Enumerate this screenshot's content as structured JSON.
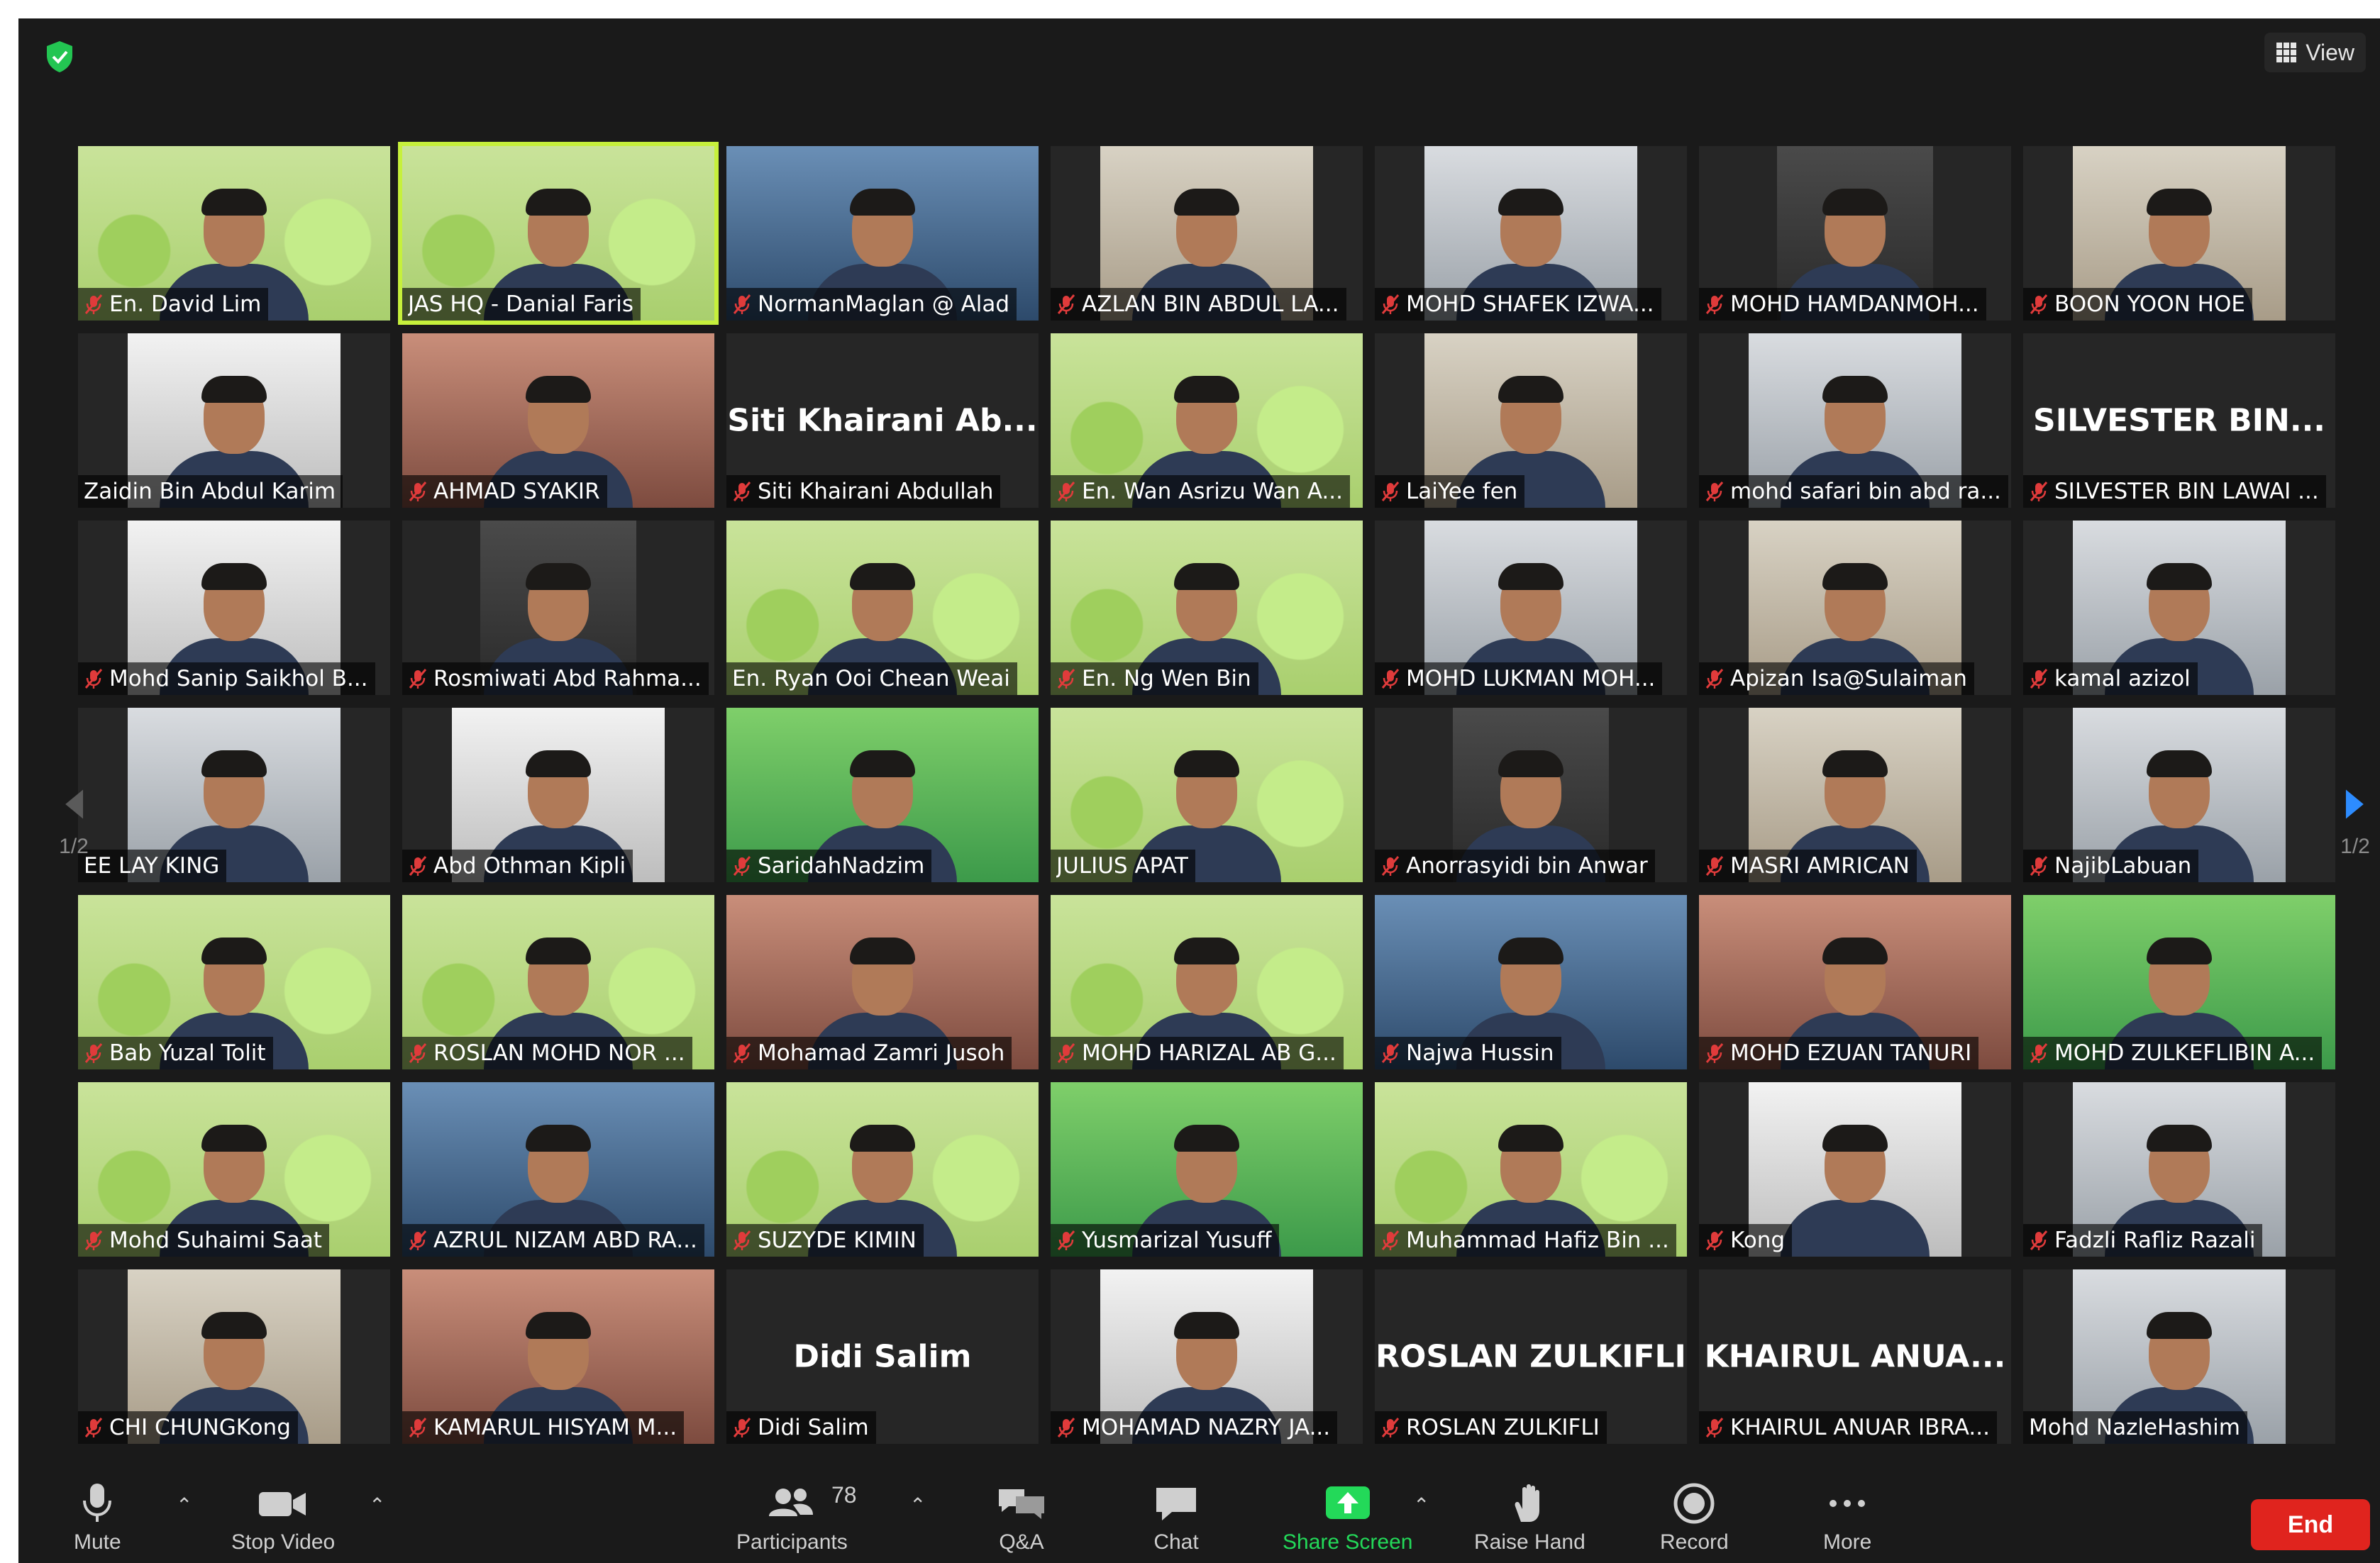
{
  "header": {
    "view_label": "View"
  },
  "pagination": {
    "left": "1/2",
    "right": "1/2"
  },
  "participants": [
    {
      "label": "En. David Lim",
      "muted": true,
      "bg": "banner"
    },
    {
      "label": "JAS HQ - Danial Faris",
      "muted": false,
      "bg": "banner",
      "active": true
    },
    {
      "label": "NormanMaglan @ Alad",
      "muted": true,
      "bg": "blue"
    },
    {
      "label": "AZLAN BIN ABDUL LA...",
      "muted": true,
      "bg": "room"
    },
    {
      "label": "MOHD SHAFEK IZWA...",
      "muted": true,
      "bg": "office"
    },
    {
      "label": "MOHD HAMDANMOH...",
      "muted": true,
      "bg": "dark"
    },
    {
      "label": "BOON YOON HOE",
      "muted": true,
      "bg": "room"
    },
    {
      "label": "Zaidin Bin Abdul Karim",
      "muted": false,
      "bg": "ceiling"
    },
    {
      "label": "AHMAD SYAKIR",
      "muted": true,
      "bg": "red"
    },
    {
      "label": "Siti Khairani Abdullah",
      "muted": true,
      "bg": "plain",
      "name_text": "Siti Khairani Ab..."
    },
    {
      "label": "En. Wan Asrizu Wan A...",
      "muted": true,
      "bg": "banner"
    },
    {
      "label": "LaiYee fen",
      "muted": true,
      "bg": "room"
    },
    {
      "label": "mohd safari bin abd ra...",
      "muted": true,
      "bg": "office"
    },
    {
      "label": "SILVESTER BIN LAWAI ...",
      "muted": true,
      "bg": "plain",
      "name_text": "SILVESTER BIN..."
    },
    {
      "label": "Mohd Sanip Saikhol B...",
      "muted": true,
      "bg": "ceiling"
    },
    {
      "label": "Rosmiwati Abd Rahma...",
      "muted": true,
      "bg": "dark"
    },
    {
      "label": "En. Ryan Ooi Chean Weai",
      "muted": false,
      "bg": "banner"
    },
    {
      "label": "En. Ng Wen Bin",
      "muted": true,
      "bg": "banner"
    },
    {
      "label": "MOHD LUKMAN MOH...",
      "muted": true,
      "bg": "office"
    },
    {
      "label": "Apizan Isa@Sulaiman",
      "muted": true,
      "bg": "room"
    },
    {
      "label": "kamal azizol",
      "muted": true,
      "bg": "office"
    },
    {
      "label": "EE LAY KING",
      "muted": false,
      "bg": "office"
    },
    {
      "label": "Abd Othman Kipli",
      "muted": true,
      "bg": "ceiling"
    },
    {
      "label": "SaridahNadzim",
      "muted": true,
      "bg": "green"
    },
    {
      "label": "JULIUS APAT",
      "muted": false,
      "bg": "banner"
    },
    {
      "label": "Anorrasyidi bin Anwar",
      "muted": true,
      "bg": "dark"
    },
    {
      "label": "MASRI AMRICAN",
      "muted": true,
      "bg": "room"
    },
    {
      "label": "NajibLabuan",
      "muted": true,
      "bg": "office"
    },
    {
      "label": "Bab Yuzal Tolit",
      "muted": true,
      "bg": "banner"
    },
    {
      "label": "ROSLAN MOHD NOR ...",
      "muted": true,
      "bg": "banner"
    },
    {
      "label": "Mohamad Zamri Jusoh",
      "muted": true,
      "bg": "red"
    },
    {
      "label": "MOHD HARIZAL AB G...",
      "muted": true,
      "bg": "banner"
    },
    {
      "label": "Najwa Hussin",
      "muted": true,
      "bg": "blue"
    },
    {
      "label": "MOHD EZUAN TANURI",
      "muted": true,
      "bg": "red"
    },
    {
      "label": "MOHD ZULKEFLIBIN A...",
      "muted": true,
      "bg": "green"
    },
    {
      "label": "Mohd Suhaimi Saat",
      "muted": true,
      "bg": "banner"
    },
    {
      "label": "AZRUL NIZAM ABD RA...",
      "muted": true,
      "bg": "blue"
    },
    {
      "label": "SUZYDE KIMIN",
      "muted": true,
      "bg": "banner"
    },
    {
      "label": "Yusmarizal Yusuff",
      "muted": true,
      "bg": "green"
    },
    {
      "label": "Muhammad Hafiz Bin ...",
      "muted": true,
      "bg": "banner"
    },
    {
      "label": "Kong",
      "muted": true,
      "bg": "ceiling"
    },
    {
      "label": "Fadzli Rafliz Razali",
      "muted": true,
      "bg": "office"
    },
    {
      "label": "CHI CHUNGKong",
      "muted": true,
      "bg": "room"
    },
    {
      "label": "KAMARUL HISYAM M...",
      "muted": true,
      "bg": "red"
    },
    {
      "label": "Didi Salim",
      "muted": true,
      "bg": "plain",
      "name_text": "Didi Salim"
    },
    {
      "label": "MOHAMAD NAZRY JA...",
      "muted": true,
      "bg": "ceiling"
    },
    {
      "label": "ROSLAN ZULKIFLI",
      "muted": true,
      "bg": "plain",
      "name_text": "ROSLAN ZULKIFLI"
    },
    {
      "label": "KHAIRUL ANUAR IBRA...",
      "muted": true,
      "bg": "plain",
      "name_text": "KHAIRUL  ANUA..."
    },
    {
      "label": "Mohd NazleHashim",
      "muted": false,
      "bg": "office"
    }
  ],
  "toolbar": {
    "mute": "Mute",
    "stop_video": "Stop Video",
    "participants": "Participants",
    "participant_count": "78",
    "qa": "Q&A",
    "chat": "Chat",
    "share_screen": "Share Screen",
    "raise_hand": "Raise Hand",
    "record": "Record",
    "more": "More",
    "end": "End"
  },
  "icons": {
    "security": "shield-check-icon",
    "view": "grid-icon",
    "mute": "microphone-icon",
    "video": "camera-icon",
    "participants": "people-icon",
    "qa": "speech-bubbles-icon",
    "chat": "chat-bubble-icon",
    "share": "share-arrow-icon",
    "raise_hand": "hand-icon",
    "record": "record-icon",
    "more": "more-dots-icon"
  },
  "colors": {
    "background": "#1a1a1a",
    "active_speaker": "#c6f03c",
    "share_green": "#23d959",
    "end_red": "#e0241e",
    "page_arrow_blue": "#2d8cff",
    "muted_red": "#e03b3b"
  }
}
